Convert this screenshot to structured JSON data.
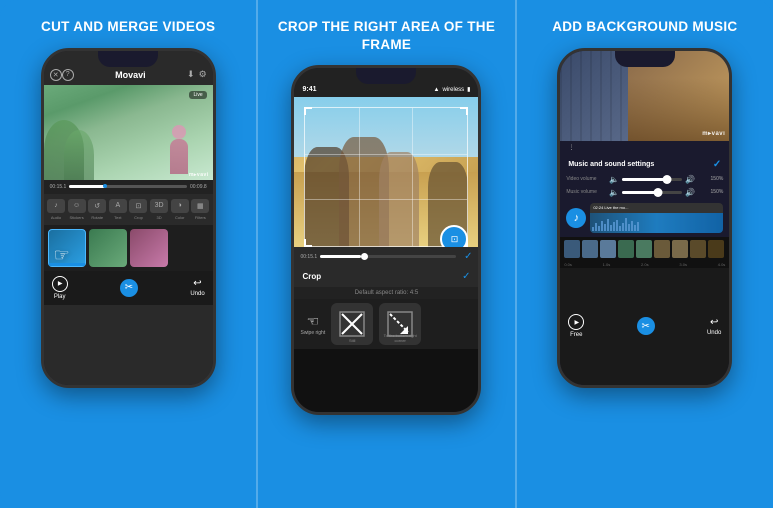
{
  "panels": [
    {
      "id": "cut-merge",
      "title": "CUT AND MERGE\nVIDEOS",
      "bottomButtons": {
        "play": "Play",
        "cut": "✂",
        "undo": "Undo"
      },
      "toolbar": {
        "items": [
          "Audio",
          "Stickers",
          "Rotate",
          "Text",
          "Crop",
          "3D",
          "Color",
          "Filters"
        ]
      },
      "timeline": {
        "startTime": "00:15.1",
        "endTime": "00:09.8"
      }
    },
    {
      "id": "crop-area",
      "title": "CROP THE RIGHT AREA\nOF THE FRAME",
      "cropLabel": "Crop",
      "defaultAspect": "Default aspect ratio: 4:5",
      "swipeLabel": "Swipe right",
      "options": [
        {
          "label": "Still",
          "selected": false
        },
        {
          "label": "To the bottom right quarter",
          "selected": false
        }
      ],
      "timeline": {
        "startTime": "00:15.1"
      }
    },
    {
      "id": "add-music",
      "title": "ADD BACKGROUND\nMUSIC",
      "settingsLabel": "Music and sound settings",
      "videoVolumeLabel": "Video volume",
      "videoVolumePct": "150%",
      "musicVolumeLabel": "Music volume",
      "musicVolumePct": "150%",
      "musicTrackLabel": "02:24 Live the mo...",
      "bottomLabels": {
        "play": "Free",
        "cut": "✂",
        "undo": "Undo"
      }
    }
  ],
  "brand": {
    "name": "Movavi",
    "logo": "m▸vavi",
    "logoAlt": "movavi"
  },
  "statusBar": {
    "time": "9:41",
    "icons": [
      "signal",
      "wifi",
      "battery"
    ]
  },
  "colors": {
    "accent": "#1a8fe3",
    "background": "#1a8fe3",
    "phoneDark": "#1a1a2e",
    "darkSurface": "#2a2a2a"
  }
}
